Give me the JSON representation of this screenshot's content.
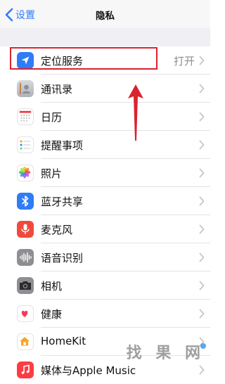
{
  "nav": {
    "back_label": "设置",
    "title": "隐私"
  },
  "rows": [
    {
      "label": "定位服务",
      "value": "打开",
      "icon": "location-arrow-icon",
      "icon_color": "#2f7cf6"
    },
    {
      "label": "通讯录",
      "value": "",
      "icon": "contacts-icon",
      "icon_color": "#b9bdc4"
    },
    {
      "label": "日历",
      "value": "",
      "icon": "calendar-icon",
      "icon_color": "#ffffff"
    },
    {
      "label": "提醒事项",
      "value": "",
      "icon": "reminders-icon",
      "icon_color": "#ffffff"
    },
    {
      "label": "照片",
      "value": "",
      "icon": "photos-icon",
      "icon_color": "#ffffff"
    },
    {
      "label": "蓝牙共享",
      "value": "",
      "icon": "bluetooth-icon",
      "icon_color": "#2f7cf6"
    },
    {
      "label": "麦克风",
      "value": "",
      "icon": "microphone-icon",
      "icon_color": "#f04a3d"
    },
    {
      "label": "语音识别",
      "value": "",
      "icon": "speech-wave-icon",
      "icon_color": "#8e8e93"
    },
    {
      "label": "相机",
      "value": "",
      "icon": "camera-icon",
      "icon_color": "#8e8e93"
    },
    {
      "label": "健康",
      "value": "",
      "icon": "health-heart-icon",
      "icon_color": "#ffffff"
    },
    {
      "label": "HomeKit",
      "value": "",
      "icon": "homekit-house-icon",
      "icon_color": "#ffffff"
    },
    {
      "label": "媒体与Apple Music",
      "value": "",
      "icon": "music-icon",
      "icon_color": "#fc3c44"
    }
  ],
  "annotation": {
    "box_color": "#d9232e",
    "arrow_color": "#d9232e"
  },
  "watermark": {
    "text": "找 果 网"
  }
}
